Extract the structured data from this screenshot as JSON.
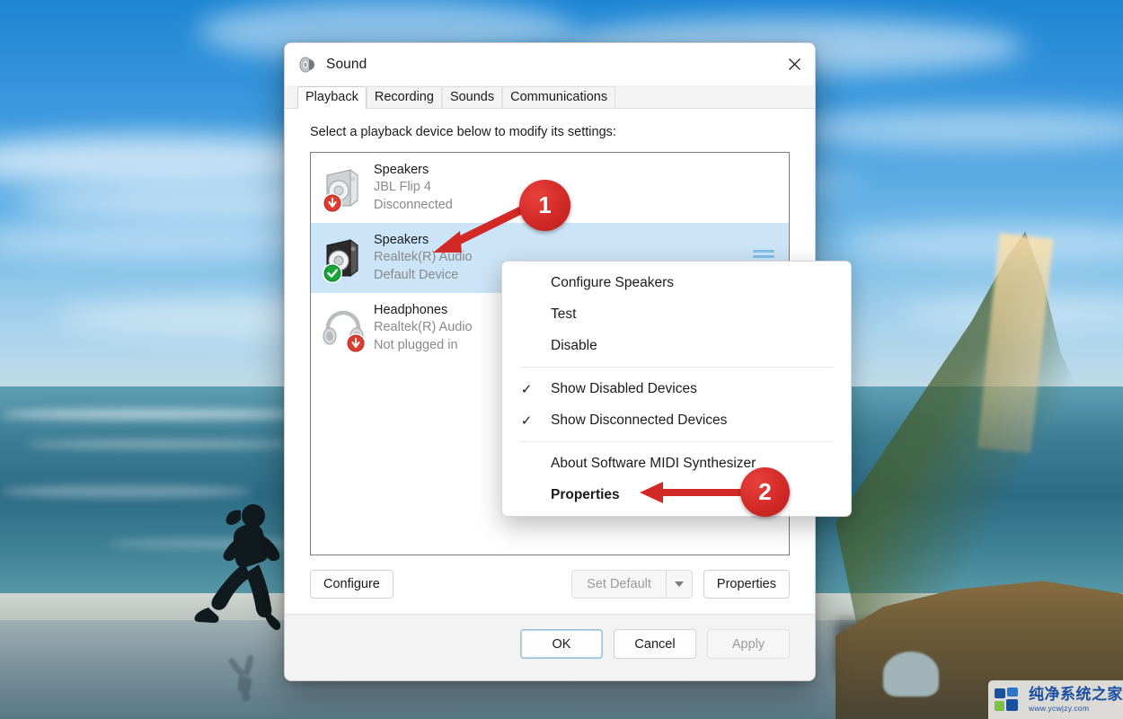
{
  "window": {
    "title": "Sound",
    "title_icon": "speaker-icon",
    "close_label": "✕"
  },
  "tabs": [
    {
      "label": "Playback",
      "active": true
    },
    {
      "label": "Recording",
      "active": false
    },
    {
      "label": "Sounds",
      "active": false
    },
    {
      "label": "Communications",
      "active": false
    }
  ],
  "panel": {
    "hint": "Select a playback device below to modify its settings:"
  },
  "devices": [
    {
      "name": "Speakers",
      "driver": "JBL Flip 4",
      "status": "Disconnected",
      "icon": "speaker-box-icon",
      "badge": "down-arrow-red-badge",
      "selected": false,
      "levels": false
    },
    {
      "name": "Speakers",
      "driver": "Realtek(R) Audio",
      "status": "Default Device",
      "icon": "speaker-box-icon",
      "badge": "check-green-badge",
      "selected": true,
      "levels": true
    },
    {
      "name": "Headphones",
      "driver": "Realtek(R) Audio",
      "status": "Not plugged in",
      "icon": "headphones-icon",
      "badge": "down-arrow-red-badge",
      "selected": false,
      "levels": false
    }
  ],
  "action_buttons": {
    "configure": "Configure",
    "set_default": "Set Default",
    "set_default_disabled": true,
    "set_default_caret": "chevron-down-icon",
    "properties": "Properties"
  },
  "footer_buttons": {
    "ok": "OK",
    "cancel": "Cancel",
    "apply": "Apply",
    "apply_disabled": true
  },
  "context_menu": {
    "items": [
      {
        "label": "Configure Speakers",
        "checked": false,
        "bold": false
      },
      {
        "label": "Test",
        "checked": false,
        "bold": false
      },
      {
        "label": "Disable",
        "checked": false,
        "bold": false
      },
      {
        "separator": true
      },
      {
        "label": "Show Disabled Devices",
        "checked": true,
        "bold": false
      },
      {
        "label": "Show Disconnected Devices",
        "checked": true,
        "bold": false
      },
      {
        "separator": true
      },
      {
        "label": "About Software MIDI Synthesizer",
        "checked": false,
        "bold": false
      },
      {
        "label": "Properties",
        "checked": false,
        "bold": true
      }
    ],
    "check_glyph": "✓"
  },
  "annotations": [
    {
      "number": "1",
      "target": "selected-speakers-device"
    },
    {
      "number": "2",
      "target": "context-menu-properties"
    }
  ],
  "watermark": {
    "name": "纯净系统之家",
    "url": "www.ycwjzy.com"
  },
  "colors": {
    "selection": "#cce4f7",
    "annotation_red": "#d32a27",
    "default_button_border": "#9cc0d8",
    "watermark_blue": "#1b4fa0"
  }
}
